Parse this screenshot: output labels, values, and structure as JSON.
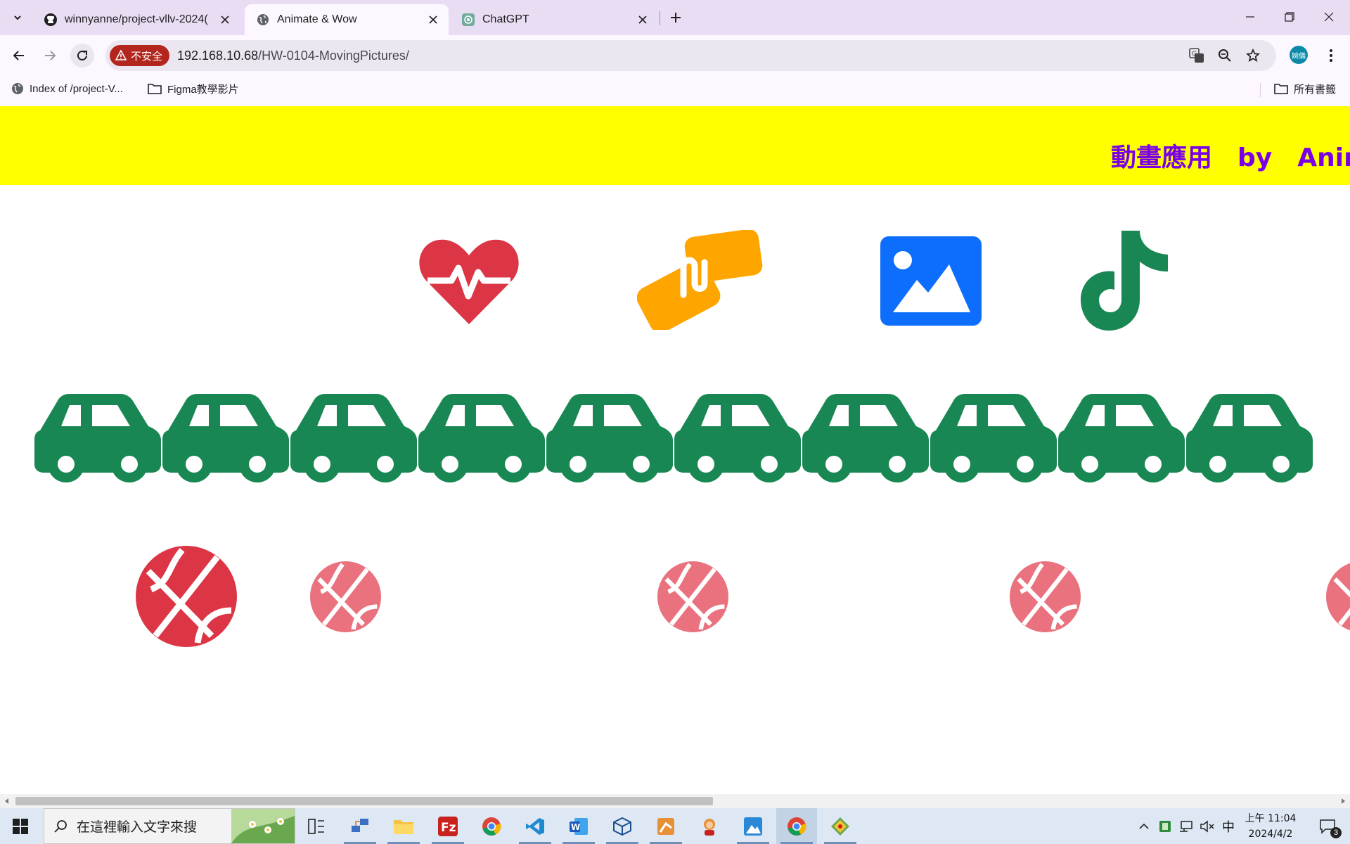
{
  "tabs": [
    {
      "title": "winnyanne/project-vllv-2024(",
      "favicon": "github-icon",
      "active": false
    },
    {
      "title": "Animate & Wow",
      "favicon": "globe-icon",
      "active": true
    },
    {
      "title": "ChatGPT",
      "favicon": "chatgpt-icon",
      "active": false
    }
  ],
  "omnibox": {
    "security_label": "不安全",
    "host": "192.168.10.68",
    "path": "/HW-0104-MovingPictures/"
  },
  "profile": {
    "label": "婉儀"
  },
  "bookmarks": [
    {
      "label": "Index of /project-V...",
      "icon": "globe-icon"
    },
    {
      "label": "Figma教學影片",
      "icon": "folder-icon"
    }
  ],
  "all_bookmarks": {
    "label": "所有書籤",
    "icon": "folder-icon"
  },
  "page": {
    "marquee": {
      "part1": "動畫應用",
      "part2": "by",
      "part3": "Animat"
    },
    "icons_row1": [
      "heart-pulse-icon",
      "handshake-icon",
      "image-icon",
      "tiktok-icon"
    ],
    "cars_count": 10,
    "car_color": "#198754",
    "basketball_colors": {
      "primary": "#dc3545",
      "faded": "#e9727e"
    }
  },
  "taskbar": {
    "search_placeholder": "在這裡輸入文字來搜",
    "ime": "中",
    "clock_time": "上午 11:04",
    "clock_date": "2024/4/2",
    "notifications": "3"
  }
}
